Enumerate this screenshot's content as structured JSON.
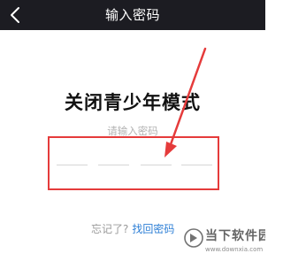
{
  "nav": {
    "title": "输入密码",
    "back_icon": "chevron-left-icon"
  },
  "main": {
    "heading": "关闭青少年模式",
    "prompt": "请输入密码",
    "pin_length": 4,
    "pin_filled": 0
  },
  "footer": {
    "forgot_text": "忘记了?",
    "recover_link": "找回密码"
  },
  "watermark": {
    "name": "当下软件园",
    "url": "www.downxia.com"
  },
  "colors": {
    "nav_background": "#1c1c22",
    "highlight": "#e53b3b",
    "link": "#2d7fd6"
  }
}
